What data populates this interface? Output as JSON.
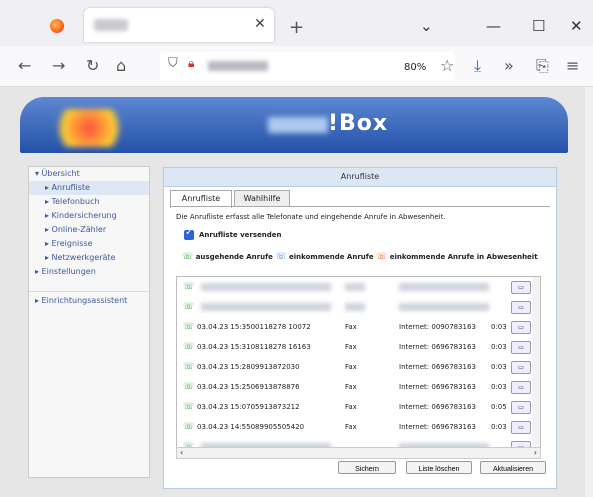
{
  "browser": {
    "zoom": "80%",
    "icons": [
      "firefox-icon",
      "close-icon",
      "plus-icon",
      "chevron-down-icon",
      "minimize-icon",
      "maximize-icon",
      "window-close-icon",
      "back-icon",
      "forward-icon",
      "reload-icon",
      "home-icon",
      "shield-icon",
      "lock-icon",
      "star-icon",
      "download-icon",
      "overflow-icon",
      "extensions-icon",
      "menu-icon"
    ]
  },
  "banner": {
    "title": "!Box"
  },
  "sidebar": {
    "items": [
      {
        "label": "▾ Übersicht"
      },
      {
        "label": "▸ Anrufliste"
      },
      {
        "label": "▸ Telefonbuch"
      },
      {
        "label": "▸ Kindersicherung"
      },
      {
        "label": "▸ Online-Zähler"
      },
      {
        "label": "▸ Ereignisse"
      },
      {
        "label": "▸ Netzwerkgeräte"
      },
      {
        "label": "▸ Einstellungen"
      },
      {
        "label": "▸ Einrichtungsassistent"
      }
    ]
  },
  "content": {
    "header": "Anrufliste",
    "tabs": [
      "Anrufliste",
      "Wahlhilfe"
    ],
    "description": "Die Anrufliste erfasst alle Telefonate und eingehende Anrufe in Abwesenheit.",
    "checkbox_label": "Anrufliste versenden",
    "legend": {
      "outgoing": "ausgehende Anrufe",
      "incoming": "einkommende Anrufe",
      "missed": "einkommende Anrufe in Abwesenheit"
    },
    "rows": [
      {
        "datetime": "03.04.23 15:35",
        "number": "00118278 10072",
        "type": "Fax",
        "internet": "Internet: 0090783163",
        "duration": "0:03"
      },
      {
        "datetime": "03.04.23 15:31",
        "number": "08118278 16163",
        "type": "Fax",
        "internet": "Internet: 0696783163",
        "duration": "0:03"
      },
      {
        "datetime": "03.04.23 15:28",
        "number": "09913872030",
        "type": "Fax",
        "internet": "Internet: 0696783163",
        "duration": "0:03"
      },
      {
        "datetime": "03.04.23 15:25",
        "number": "06913878876",
        "type": "Fax",
        "internet": "Internet: 0696783163",
        "duration": "0:03"
      },
      {
        "datetime": "03.04.23 15:07",
        "number": "05913873212",
        "type": "Fax",
        "internet": "Internet: 0696783163",
        "duration": "0:05"
      },
      {
        "datetime": "03.04.23 14:55",
        "number": "089905505420",
        "type": "Fax",
        "internet": "Internet: 0696783163",
        "duration": "0:03"
      }
    ],
    "buttons": {
      "save": "Sichern",
      "clear": "Liste löschen",
      "refresh": "Aktualisieren"
    }
  }
}
